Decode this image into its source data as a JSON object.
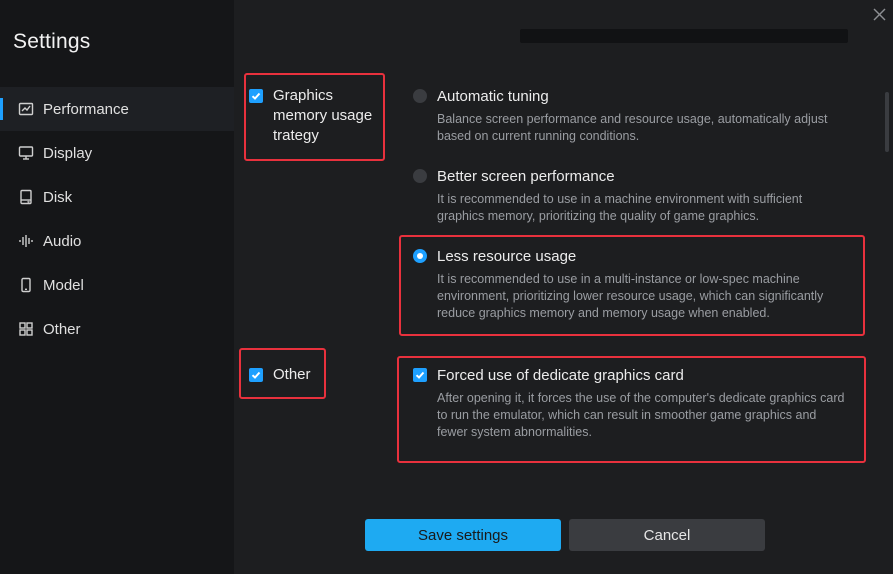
{
  "window": {
    "title": "Settings"
  },
  "sidebar": {
    "items": [
      {
        "label": "Performance",
        "icon": "chart-icon",
        "active": true
      },
      {
        "label": "Display",
        "icon": "monitor-icon",
        "active": false
      },
      {
        "label": "Disk",
        "icon": "disk-icon",
        "active": false
      },
      {
        "label": "Audio",
        "icon": "audio-wave-icon",
        "active": false
      },
      {
        "label": "Model",
        "icon": "phone-icon",
        "active": false
      },
      {
        "label": "Other",
        "icon": "grid-icon",
        "active": false
      }
    ]
  },
  "sections": {
    "graphics_memory": {
      "label": "Graphics memory usage trategy",
      "checked": true,
      "options": [
        {
          "title": "Automatic tuning",
          "description": "Balance screen performance and resource usage, automatically adjust based on current running conditions.",
          "selected": false
        },
        {
          "title": "Better screen performance",
          "description": "It is recommended to use in a machine environment with sufficient graphics memory, prioritizing the quality of game graphics.",
          "selected": false
        },
        {
          "title": "Less resource usage",
          "description": "It is recommended to use in a multi-instance or low-spec machine environment, prioritizing lower resource usage, which can significantly reduce graphics memory and memory usage when enabled.",
          "selected": true
        }
      ]
    },
    "other": {
      "label": "Other",
      "checked": true,
      "option": {
        "title": "Forced use of dedicate graphics card",
        "description": "After opening it, it forces the use of the computer's dedicate graphics card to run the emulator, which can result in smoother game graphics and fewer system abnormalities.",
        "checked": true
      }
    }
  },
  "buttons": {
    "save": "Save settings",
    "cancel": "Cancel"
  },
  "colors": {
    "accent": "#1ea0ff",
    "highlight": "#e8313d",
    "background": "#1d1e20",
    "sidebar": "#151618"
  }
}
